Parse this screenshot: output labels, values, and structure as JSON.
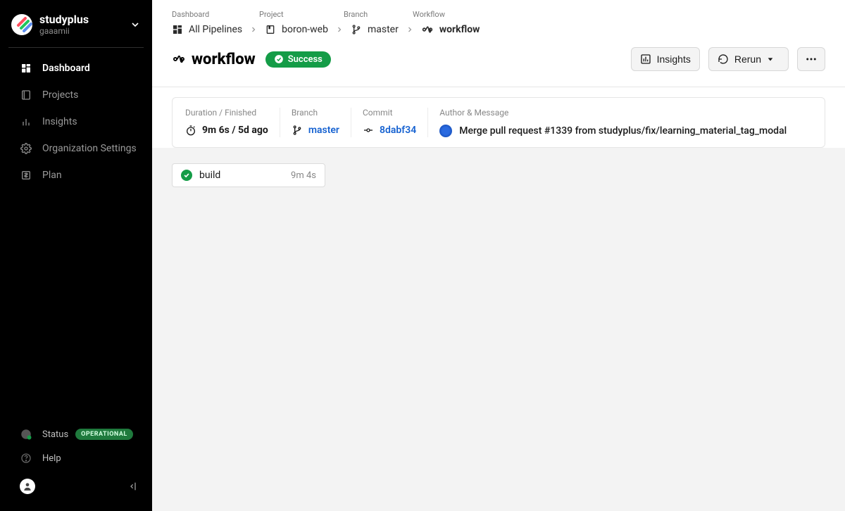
{
  "sidebar": {
    "org_name": "studyplus",
    "username": "gaaamii",
    "nav": {
      "dashboard": "Dashboard",
      "projects": "Projects",
      "insights": "Insights",
      "org_settings": "Organization Settings",
      "plan": "Plan"
    },
    "status_label": "Status",
    "status_badge": "OPERATIONAL",
    "help": "Help"
  },
  "breadcrumb": {
    "labels": {
      "dashboard": "Dashboard",
      "project": "Project",
      "branch": "Branch",
      "workflow": "Workflow"
    },
    "all_pipelines": "All Pipelines",
    "project": "boron-web",
    "branch": "master",
    "workflow": "workflow"
  },
  "title": {
    "text": "workflow",
    "badge": "Success"
  },
  "actions": {
    "insights": "Insights",
    "rerun": "Rerun"
  },
  "summary": {
    "duration_label": "Duration / Finished",
    "duration_value": "9m 6s / 5d ago",
    "branch_label": "Branch",
    "branch_value": "master",
    "commit_label": "Commit",
    "commit_value": "8dabf34",
    "author_label": "Author & Message",
    "author_message": "Merge pull request #1339 from studyplus/fix/learning_material_tag_modal"
  },
  "jobs": {
    "build": {
      "name": "build",
      "time": "9m 4s"
    }
  }
}
